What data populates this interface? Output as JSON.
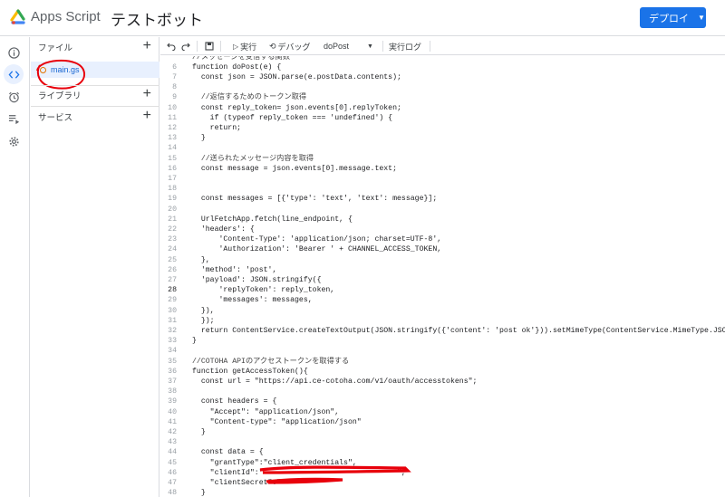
{
  "app": {
    "name": "Apps Script",
    "project_title": "テストボット",
    "deploy_label": "デプロイ"
  },
  "rail": [
    {
      "icon": "info-icon"
    },
    {
      "icon": "code-icon"
    },
    {
      "icon": "clock-icon"
    },
    {
      "icon": "executions-icon"
    },
    {
      "icon": "gear-icon"
    }
  ],
  "panel": {
    "files_label": "ファイル",
    "file_name": "main.gs",
    "libraries_label": "ライブラリ",
    "services_label": "サービス"
  },
  "toolbar": {
    "run_label": "実行",
    "debug_label": "デバッグ",
    "function_select": "doPost",
    "log_label": "実行ログ"
  },
  "editor": {
    "current_line": 28,
    "lines": [
      {
        "n": "",
        "t": "//メッセージを受信する関数"
      },
      {
        "n": "6",
        "t": "function doPost(e) {"
      },
      {
        "n": "7",
        "t": "  const json = JSON.parse(e.postData.contents);"
      },
      {
        "n": "8",
        "t": ""
      },
      {
        "n": "9",
        "t": "  //返信するためのトークン取得"
      },
      {
        "n": "10",
        "t": "  const reply_token= json.events[0].replyToken;"
      },
      {
        "n": "11",
        "t": "    if (typeof reply_token === 'undefined') {"
      },
      {
        "n": "12",
        "t": "    return;"
      },
      {
        "n": "13",
        "t": "  }"
      },
      {
        "n": "14",
        "t": ""
      },
      {
        "n": "15",
        "t": "  //送られたメッセージ内容を取得"
      },
      {
        "n": "16",
        "t": "  const message = json.events[0].message.text;"
      },
      {
        "n": "17",
        "t": ""
      },
      {
        "n": "18",
        "t": ""
      },
      {
        "n": "19",
        "t": "  const messages = [{'type': 'text', 'text': message}];"
      },
      {
        "n": "20",
        "t": ""
      },
      {
        "n": "21",
        "t": "  UrlFetchApp.fetch(line_endpoint, {"
      },
      {
        "n": "22",
        "t": "  'headers': {"
      },
      {
        "n": "23",
        "t": "      'Content-Type': 'application/json; charset=UTF-8',"
      },
      {
        "n": "24",
        "t": "      'Authorization': 'Bearer ' + CHANNEL_ACCESS_TOKEN,"
      },
      {
        "n": "25",
        "t": "  },"
      },
      {
        "n": "26",
        "t": "  'method': 'post',"
      },
      {
        "n": "27",
        "t": "  'payload': JSON.stringify({"
      },
      {
        "n": "28",
        "t": "      'replyToken': reply_token,"
      },
      {
        "n": "29",
        "t": "      'messages': messages,"
      },
      {
        "n": "30",
        "t": "  }),"
      },
      {
        "n": "31",
        "t": "  });"
      },
      {
        "n": "32",
        "t": "  return ContentService.createTextOutput(JSON.stringify({'content': 'post ok'})).setMimeType(ContentService.MimeType.JSON);"
      },
      {
        "n": "33",
        "t": "}"
      },
      {
        "n": "34",
        "t": ""
      },
      {
        "n": "35",
        "t": "//COTOHA APIのアクセストークンを取得する"
      },
      {
        "n": "36",
        "t": "function getAccessToken(){"
      },
      {
        "n": "37",
        "t": "  const url = \"https://api.ce-cotoha.com/v1/oauth/accesstokens\";"
      },
      {
        "n": "38",
        "t": ""
      },
      {
        "n": "39",
        "t": "  const headers = {"
      },
      {
        "n": "40",
        "t": "    \"Accept\": \"application/json\","
      },
      {
        "n": "41",
        "t": "    \"Content-type\": \"application/json\""
      },
      {
        "n": "42",
        "t": "  }"
      },
      {
        "n": "43",
        "t": ""
      },
      {
        "n": "44",
        "t": "  const data = {"
      },
      {
        "n": "45",
        "t": "    \"grantType\":\"client_credentials\","
      },
      {
        "n": "46",
        "t": "    \"clientId\":\"                              \","
      },
      {
        "n": "47",
        "t": "    \"clientSecret\":\"          \""
      },
      {
        "n": "48",
        "t": "  }"
      }
    ]
  }
}
